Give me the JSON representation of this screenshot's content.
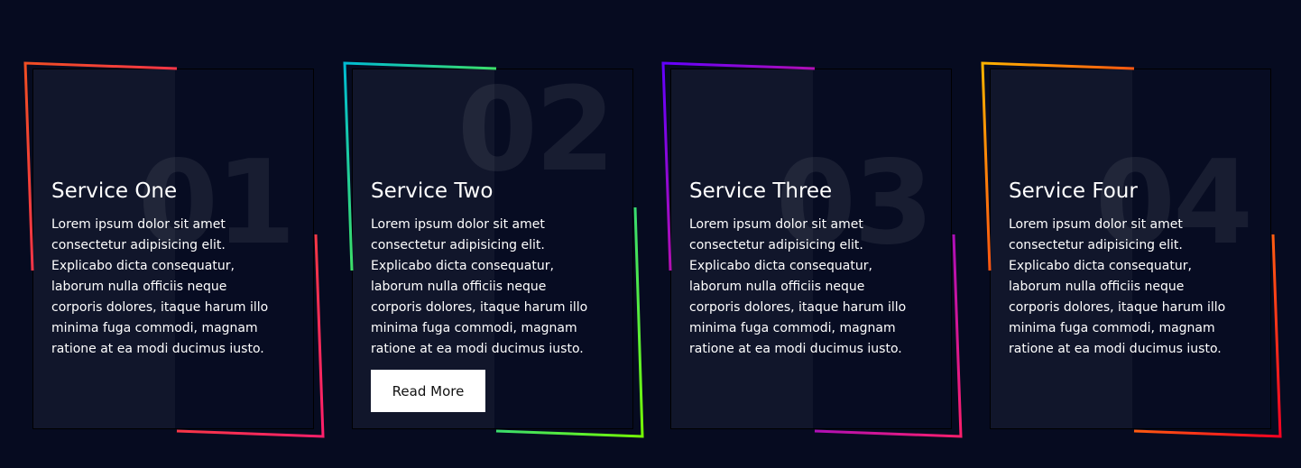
{
  "services": [
    {
      "number": "01",
      "title": "Service One",
      "text_lines": [
        "Lorem ipsum dolor sit amet",
        "consectetur adipisicing elit.",
        "Explicabo dicta consequatur,",
        "laborum nulla officiis neque",
        "corporis dolores, itaque harum illo",
        "minima fuga commodi, magnam",
        "ratione at ea modi ducimus iusto."
      ],
      "accent_start": "#f04e23",
      "accent_end": "#ff1f6b"
    },
    {
      "number": "02",
      "title": "Service Two",
      "text_lines": [
        "Lorem ipsum dolor sit amet",
        "consectetur adipisicing elit.",
        "Explicabo dicta consequatur,",
        "laborum nulla officiis neque",
        "corporis dolores, itaque harum illo",
        "minima fuga commodi, magnam",
        "ratione at ea modi ducimus iusto."
      ],
      "button_label": "Read More",
      "accent_start": "#00bcd4",
      "accent_end": "#76ff03"
    },
    {
      "number": "03",
      "title": "Service Three",
      "text_lines": [
        "Lorem ipsum dolor sit amet",
        "consectetur adipisicing elit.",
        "Explicabo dicta consequatur,",
        "laborum nulla officiis neque",
        "corporis dolores, itaque harum illo",
        "minima fuga commodi, magnam",
        "ratione at ea modi ducimus iusto."
      ],
      "accent_start": "#6200ff",
      "accent_end": "#ff1f6b"
    },
    {
      "number": "04",
      "title": "Service Four",
      "text_lines": [
        "Lorem ipsum dolor sit amet",
        "consectetur adipisicing elit.",
        "Explicabo dicta consequatur,",
        "laborum nulla officiis neque",
        "corporis dolores, itaque harum illo",
        "minima fuga commodi, magnam",
        "ratione at ea modi ducimus iusto."
      ],
      "accent_start": "#ffb300",
      "accent_end": "#ff0022"
    }
  ]
}
